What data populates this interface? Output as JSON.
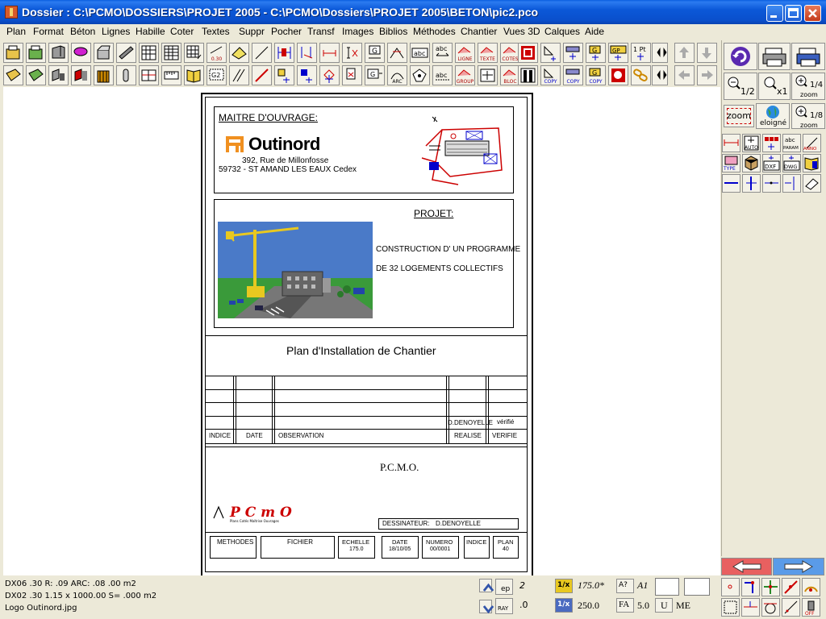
{
  "window": {
    "title": "Dossier : C:\\PCMO\\DOSSIERS\\PROJET 2005 - C:\\PCMO\\Dossiers\\PROJET 2005\\BETON\\pic2.pco"
  },
  "menu": [
    "Plan",
    "Format",
    "Béton",
    "Lignes",
    "Habille",
    "Coter",
    "Textes",
    "Suppr",
    "Pocher",
    "Transf",
    "Images",
    "Biblios",
    "Méthodes",
    "Chantier",
    "Vues 3D",
    "Calques",
    "Aide"
  ],
  "toolbar": {
    "row1_captions": [
      "",
      "",
      "",
      "",
      "",
      "",
      "",
      "",
      "",
      "0.30",
      "",
      "",
      "",
      "",
      "",
      "",
      "",
      "",
      "",
      "abc",
      "LIGNE",
      "TEXTE",
      "COTES",
      "",
      "",
      "",
      "G",
      "GP",
      "1 Pt",
      "",
      "",
      ""
    ],
    "row2_captions": [
      "",
      "",
      "",
      "",
      "",
      "",
      "",
      "",
      "",
      "G2",
      "",
      "",
      "",
      "",
      "",
      "",
      "",
      "",
      "ARC",
      "",
      "abc",
      "GROUP",
      "",
      "BLOC",
      "",
      "COPY",
      "COPY",
      "COPY",
      "",
      "",
      "",
      ""
    ]
  },
  "rightpanel": {
    "zoom_half": "1/2",
    "zoom_x1": "x1",
    "zoom_quarter": "1/4",
    "zoom_quarter_caption": "zoom",
    "zoom_label": "zoom",
    "eloigne": "eloigné",
    "zoom_eighth": "1/8",
    "zoom_eighth_caption": "zoom",
    "tool_captions": [
      "",
      "AUTO",
      "",
      "PARAM",
      "ANNO",
      "TYPE",
      "",
      "DXF",
      "DWG",
      ""
    ]
  },
  "sheet": {
    "maitre_ouvrage": "MAITRE D'OUVRAGE:",
    "company": "Outinord",
    "address1": "392, Rue de Millonfosse",
    "address2": "59732 - ST AMAND LES EAUX Cedex",
    "projet_label": "PROJET:",
    "projet_line1": "CONSTRUCTION D' UN PROGRAMME",
    "projet_line2": "DE 32 LOGEMENTS COLLECTIFS",
    "plan_title": "Plan d'Installation de Chantier",
    "revision": {
      "realise_value": "D.DENOYELLE",
      "verifie_value": "vérifié",
      "col_indice": "INDICE",
      "col_date": "DATE",
      "col_observation": "OBSERVATION",
      "col_realise": "REALISE",
      "col_verifie": "VERIFIE"
    },
    "pcmo": "P.C.M.O.",
    "pcmo_logo_text": "P C m O",
    "pcmo_logo_sub": "Plans Cotés Maîtrise Ouvrages",
    "dessinateur_label": "DESSINATEUR:",
    "dessinateur_value": "D.DENOYELLE",
    "footer": [
      {
        "label": "METHODES",
        "value": ""
      },
      {
        "label": "FICHIER",
        "value": ""
      },
      {
        "label": "ECHELLE",
        "value": "175.0"
      },
      {
        "label": "DATE",
        "value": "18/10/05"
      },
      {
        "label": "NUMERO",
        "value": "00/0001"
      },
      {
        "label": "INDICE",
        "value": ""
      },
      {
        "label": "PLAN",
        "value": "40"
      }
    ]
  },
  "status": {
    "line1": "DX06 .30 R: .09 ARC: .08 .00 m2",
    "line2": "DX02 .30 1.15 x 1000.00 S= .000 m2",
    "line3": "Logo Outinord.jpg",
    "ep_label": "ep",
    "ep_value": "2",
    "ray_label": "RAY",
    "ray_value": ".0",
    "scale1_label": "1/x",
    "scale1_value": "175.0*",
    "scale2_label": "1/x",
    "scale2_value": "250.0",
    "help_label": "A?",
    "paper": "A1",
    "fa_label": "FA",
    "fa_value": "5.0",
    "u_label": "U",
    "me_label": "ME"
  },
  "colors": {
    "titlebar": "#0A4FCB",
    "chrome": "#ECE9D8",
    "arrow_left": "#E86060",
    "arrow_right": "#5A9BE8",
    "accent_red": "#CC0000"
  }
}
